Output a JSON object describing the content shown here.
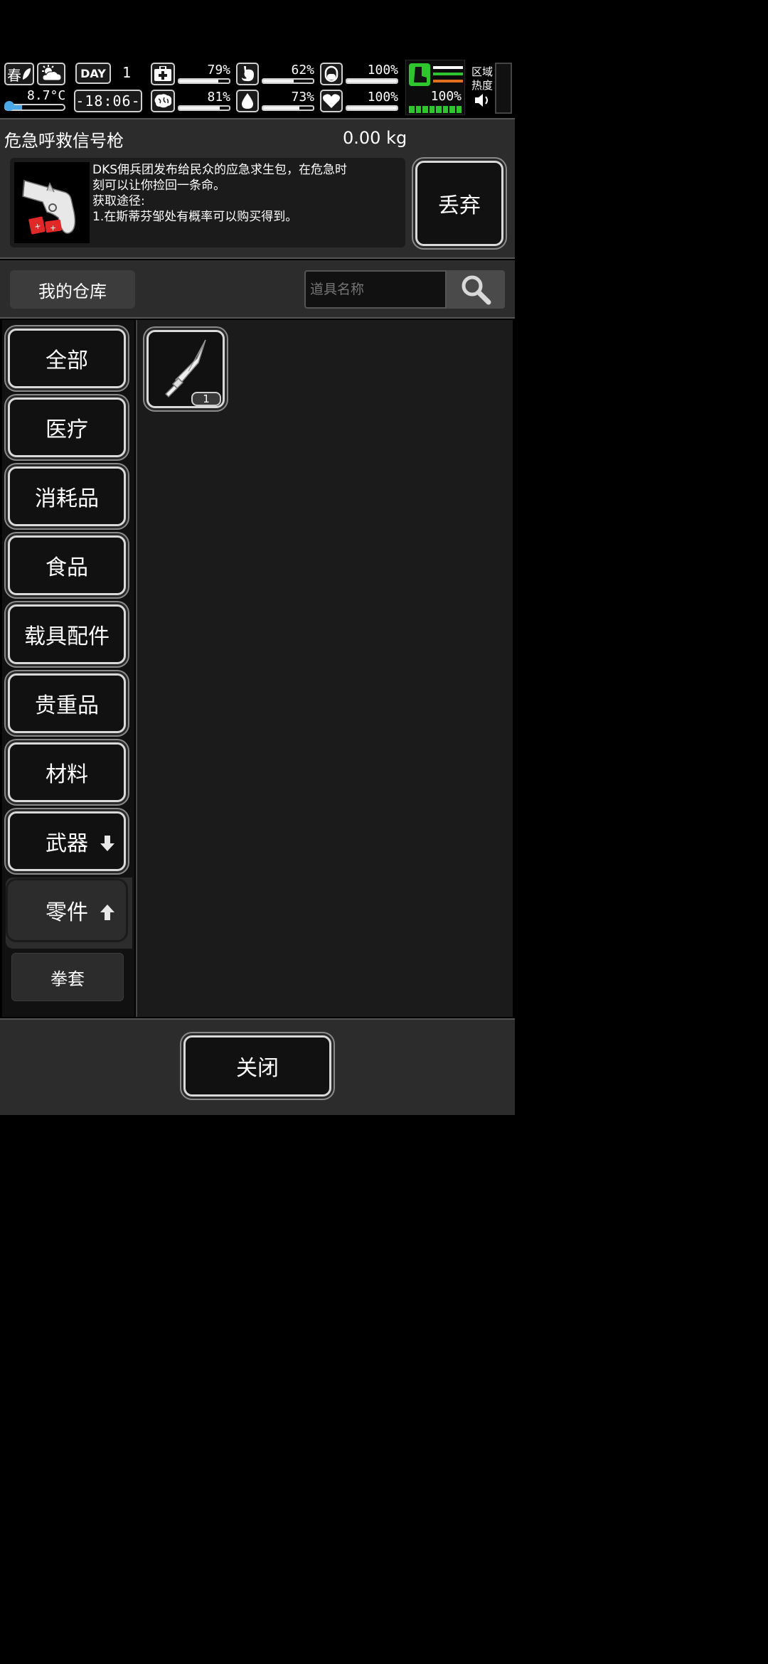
{
  "status": {
    "season": "春",
    "temperature": "8.7°C",
    "day_label": "DAY",
    "day_number": "1",
    "time": "-18:06-",
    "health_pct": "79%",
    "health_level": 0.79,
    "stomach_pct": "62%",
    "stomach_level": 0.62,
    "stamina_pct": "100%",
    "stamina_level": 1.0,
    "mental_pct": "81%",
    "mental_level": 0.81,
    "water_pct": "73%",
    "water_level": 0.73,
    "heart_pct": "100%",
    "heart_level": 1.0,
    "boot_pct": "100%",
    "region_heat_label": "区域\n热度",
    "accent_green": "#2ec52e",
    "accent_orange": "#e0701e"
  },
  "item": {
    "name": "危急呼救信号枪",
    "weight": "0.00 kg",
    "description_lines": [
      "DKS佣兵团发布给民众的应急求生包，在危急时",
      "刻可以让你捡回一条命。",
      "获取途径:",
      "1.在斯蒂芬邹处有概率可以购买得到。"
    ],
    "discard_label": "丢弃",
    "icon": "flare-gun-icon"
  },
  "warehouse": {
    "title": "我的仓库",
    "search_placeholder": "道具名称"
  },
  "categories": [
    {
      "label": "全部"
    },
    {
      "label": "医疗"
    },
    {
      "label": "消耗品"
    },
    {
      "label": "食品"
    },
    {
      "label": "载具配件"
    },
    {
      "label": "贵重品"
    },
    {
      "label": "材料"
    },
    {
      "label": "武器",
      "arrow": "down"
    },
    {
      "label": "零件",
      "arrow": "up",
      "selected": true
    }
  ],
  "subcategory": {
    "label": "拳套"
  },
  "inventory": [
    {
      "icon": "blade-icon",
      "count": "1"
    }
  ],
  "close_label": "关闭"
}
